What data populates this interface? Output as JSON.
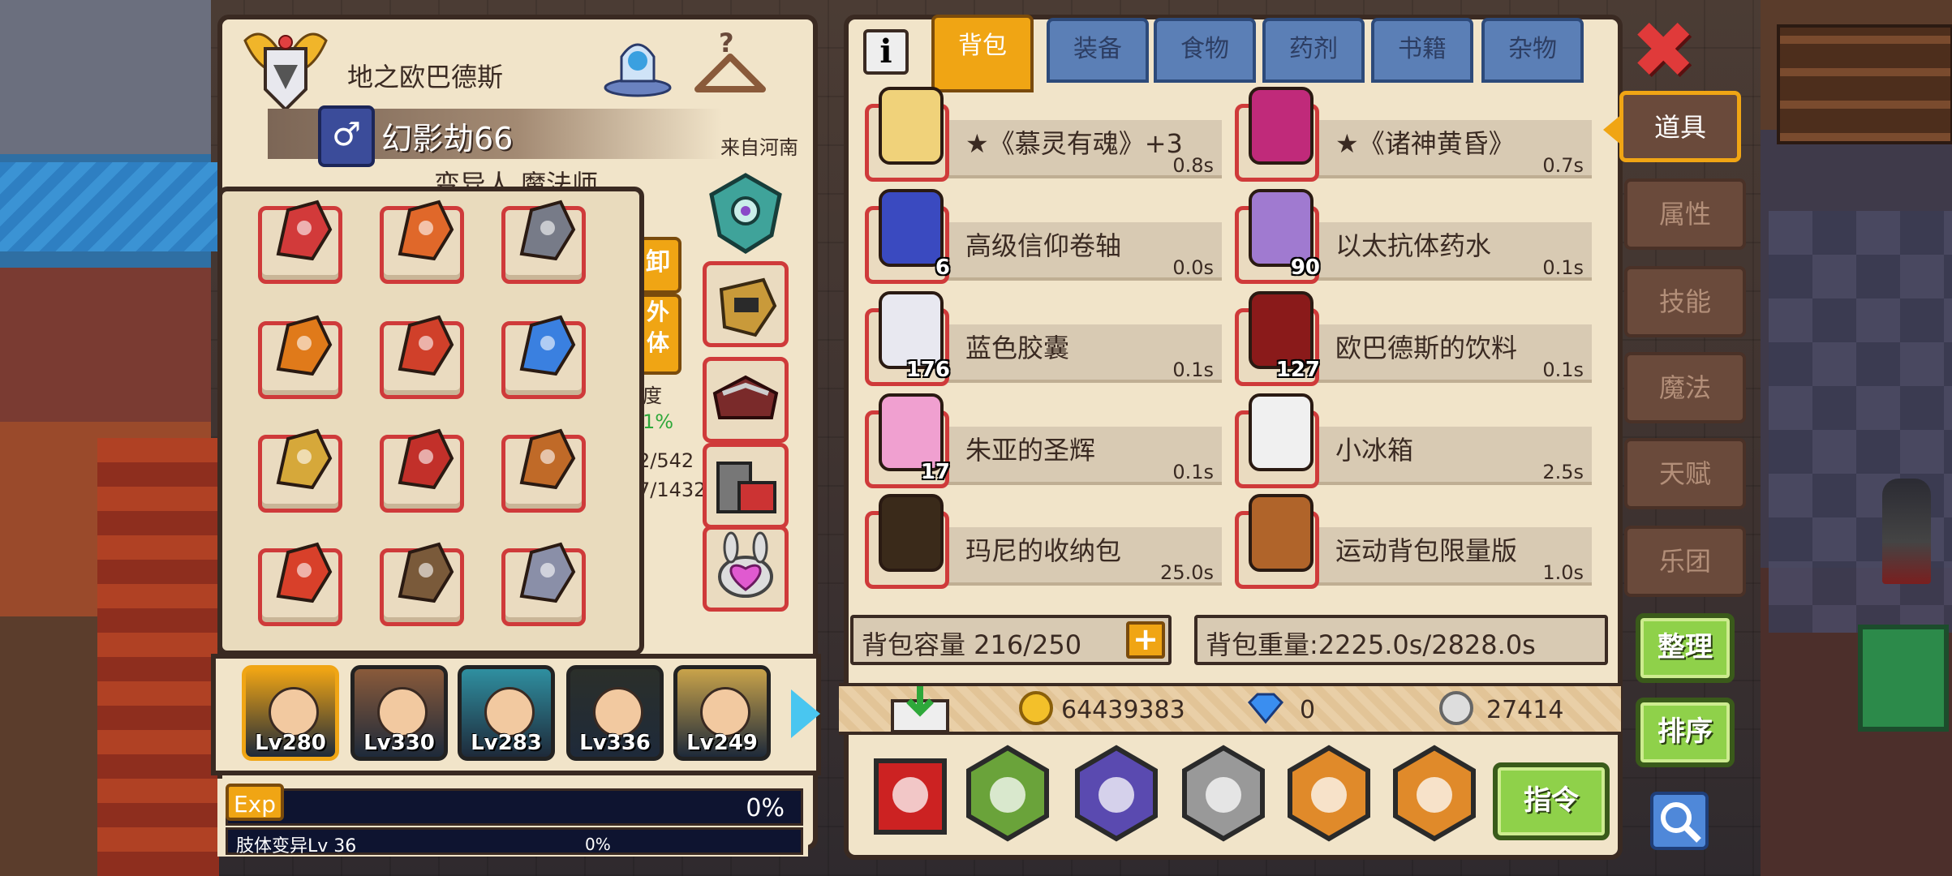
{
  "character": {
    "title": "地之欧巴德斯",
    "gender_symbol": "♂",
    "name": "幻影劫66",
    "origin": "来自河南",
    "class_text": "变异人 魔法师",
    "side_btn_1": "卸",
    "side_btn_2": "外\n体",
    "partial_labels": [
      "度",
      "1%",
      "2/542",
      "7/1432"
    ]
  },
  "equipment": {
    "slots": [
      {
        "icon": "crimson-bow-icon"
      },
      {
        "icon": "flame-spear-icon"
      },
      {
        "icon": "dragon-armor-icon"
      },
      {
        "icon": "pumpkin-shield-icon"
      },
      {
        "icon": "fire-feather-icon"
      },
      {
        "icon": "blue-ring-icon"
      },
      {
        "icon": "gold-gauntlet-icon"
      },
      {
        "icon": "ruby-amulet-icon"
      },
      {
        "icon": "sneaker-icon"
      },
      {
        "icon": "red-boots-icon"
      },
      {
        "icon": "rabbit-boots-icon"
      },
      {
        "icon": "mech-wings-icon"
      }
    ],
    "side_slots": [
      {
        "icon": "teal-crest-icon"
      },
      {
        "icon": "golden-fist-icon"
      },
      {
        "icon": "spiked-collar-icon"
      },
      {
        "icon": "iron-boots-icon"
      },
      {
        "icon": "heart-bunny-icon"
      }
    ]
  },
  "heroes": [
    {
      "level": "Lv280",
      "color": "#f0a514"
    },
    {
      "level": "Lv330",
      "color": "#8a5a3a"
    },
    {
      "level": "Lv283",
      "color": "#2f8fa0"
    },
    {
      "level": "Lv336",
      "color": "#2b2f2a"
    },
    {
      "level": "Lv249",
      "color": "#c9a34a"
    }
  ],
  "exp": {
    "label": "Exp",
    "percent": "0%",
    "sub_label": "肢体变异Lv 36",
    "sub_percent": "0%",
    "progress_fraction": 0.0
  },
  "bag": {
    "tabs": [
      {
        "label": "背包",
        "active": true
      },
      {
        "label": "装备",
        "active": false
      },
      {
        "label": "食物",
        "active": false
      },
      {
        "label": "药剂",
        "active": false
      },
      {
        "label": "书籍",
        "active": false
      },
      {
        "label": "杂物",
        "active": false
      }
    ],
    "info_label": "i",
    "close_label": "✖",
    "items": [
      {
        "name": "★《慕灵有魂》+3",
        "weight": "0.8s",
        "qty": "",
        "icon": "crown-robe-icon"
      },
      {
        "name": "★《诸神黄昏》",
        "weight": "0.7s",
        "qty": "",
        "icon": "purple-sword-icon"
      },
      {
        "name": "高级信仰卷轴",
        "weight": "0.0s",
        "qty": "6",
        "icon": "scroll-icon"
      },
      {
        "name": "以太抗体药水",
        "weight": "0.1s",
        "qty": "90",
        "icon": "potion-icon"
      },
      {
        "name": "蓝色胶囊",
        "weight": "0.1s",
        "qty": "176",
        "icon": "capsule-icon"
      },
      {
        "name": "欧巴德斯的饮料",
        "weight": "0.1s",
        "qty": "127",
        "icon": "soda-bottle-icon"
      },
      {
        "name": "朱亚的圣辉",
        "weight": "0.1s",
        "qty": "17",
        "icon": "pink-flask-icon"
      },
      {
        "name": "小冰箱",
        "weight": "2.5s",
        "qty": "",
        "icon": "fridge-icon"
      },
      {
        "name": "玛尼的收纳包",
        "weight": "25.0s",
        "qty": "",
        "icon": "book-bag-icon"
      },
      {
        "name": "运动背包限量版",
        "weight": "1.0s",
        "qty": "",
        "icon": "backpack-icon"
      }
    ],
    "capacity": "背包容量 216/250",
    "capacity_plus": "+",
    "weight": "背包重量:2225.0s/2828.0s"
  },
  "currency": {
    "gold": "64439383",
    "diamond": "0",
    "silver": "27414"
  },
  "skills": [
    {
      "icon": "dice-icon"
    },
    {
      "icon": "halberd-icon"
    },
    {
      "icon": "eye-ring-icon"
    },
    {
      "icon": "star-icon"
    },
    {
      "icon": "claw-slash-icon"
    },
    {
      "icon": "pinwheel-icon"
    }
  ],
  "command_label": "指令",
  "side_tabs": [
    {
      "label": "道具",
      "active": true
    },
    {
      "label": "属性",
      "active": false
    },
    {
      "label": "技能",
      "active": false
    },
    {
      "label": "魔法",
      "active": false
    },
    {
      "label": "天赋",
      "active": false
    },
    {
      "label": "乐团",
      "active": false
    }
  ],
  "actions": {
    "sort_label": "整理",
    "order_label": "排序"
  },
  "colors": {
    "panel_bg": "#f1e4c9",
    "border": "#3a2a22",
    "accent_orange": "#f0a514",
    "tab_blue": "#5b7fb6",
    "slot_red": "#cf3a3a",
    "green_btn": "#8fd14a"
  }
}
